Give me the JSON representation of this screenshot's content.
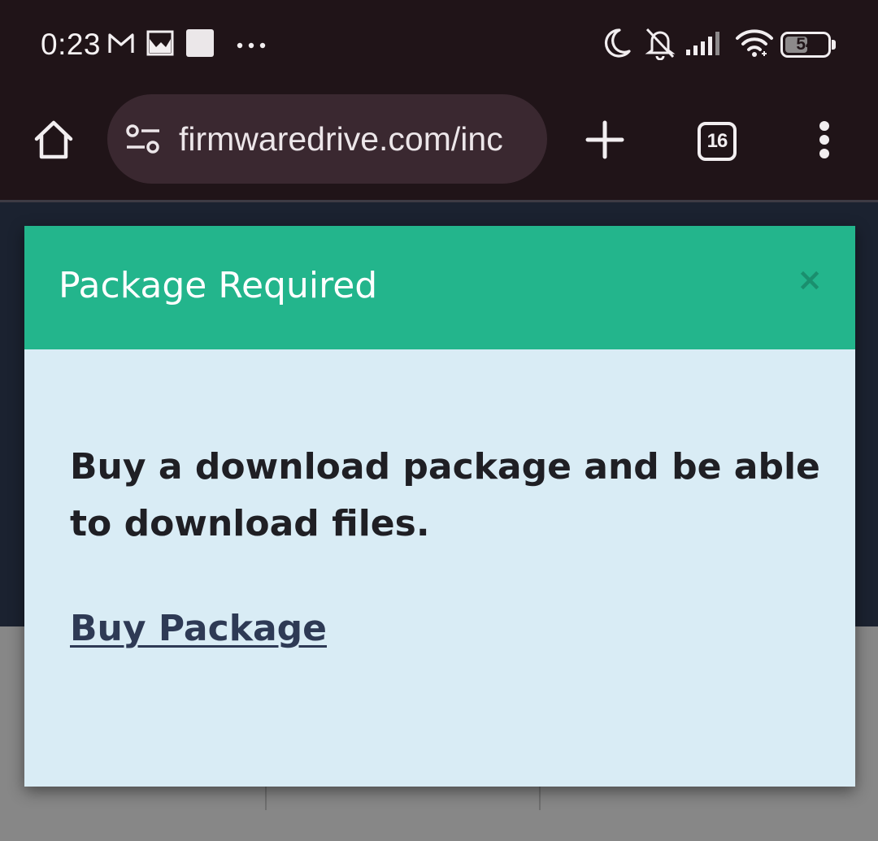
{
  "status_bar": {
    "time": "0:23",
    "left_icons": [
      "gmail-icon",
      "gallery-icon",
      "square-notification-icon",
      "more-notifications-icon"
    ],
    "right_icons": [
      "do-not-disturb-moon-icon",
      "muted-bell-icon",
      "cellular-signal-icon",
      "wifi-icon",
      "battery-icon"
    ],
    "battery_level": "54",
    "battery_fraction": 0.54
  },
  "browser": {
    "url": "firmwaredrive.com/index.php",
    "url_visible": "firmwaredrive.com/inc",
    "tab_count": "16",
    "icons": [
      "home-icon",
      "site-settings-icon",
      "plus-icon",
      "tab-switcher-icon",
      "overflow-menu-icon"
    ]
  },
  "modal": {
    "title": "Package Required",
    "close_label": "×",
    "message": "Buy a download package and be able to download files.",
    "link_label": "Buy Package"
  },
  "colors": {
    "header_green": "#23b58c",
    "modal_body": "#d9ecf5",
    "link": "#2e3a55",
    "system_bar": "#201418",
    "url_bar": "#3a2830"
  }
}
